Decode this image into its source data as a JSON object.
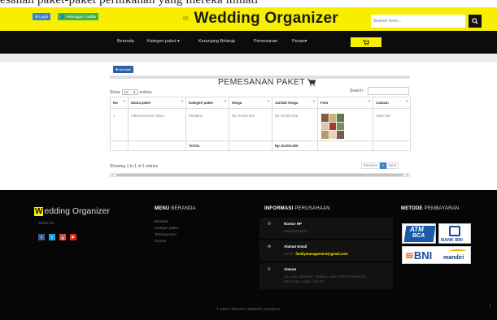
{
  "cut_text": "esanan paket-paket pernikahan yang mereka minati",
  "topbar": {
    "login_label": "⚙ Login",
    "register_label": "👤 Pelanggan / Daftar",
    "brand": "Wedding Organizer",
    "search_placeholder": "Search here..."
  },
  "nav": {
    "items": [
      "Beranda",
      "Kategori paket ▾",
      "Keranjang Belanja",
      "Pemesanan",
      "Pesan▾"
    ]
  },
  "content": {
    "back_label": "✚ Kembali",
    "title": "PEMESANAN PAKET",
    "show_label": "Show",
    "entries_value": "10",
    "entries_label": "entries",
    "search_label": "Search:",
    "columns": [
      "No",
      "Nama paket",
      "Kategori paket",
      "Harga",
      "Jumlah Harga",
      "Foto",
      "Catatan"
    ],
    "rows": [
      {
        "no": "1",
        "nama": "Paket Dekorasi Silver",
        "kategori": "Wedding",
        "harga": "Rp 15.000.000",
        "jumlah": "Rp 15.000.000",
        "catatan": "Hallo kak"
      }
    ],
    "total_label": "TOTAL",
    "total_value": "Rp 15.000.000",
    "info": "Showing 1 to 1 of 1 entries",
    "pagination": {
      "prev": "Previous",
      "page": "1",
      "next": "Next"
    }
  },
  "footer": {
    "logo_w": "W",
    "logo_rest": "edding Organizer",
    "share_label": "Share On:",
    "menu_heading_bold": "MENU",
    "menu_heading_rest": " BERANDA",
    "menu_links": [
      "Beranda",
      "Kategori paket",
      "Tentang kami",
      "Kontak"
    ],
    "info_heading_bold": "INFORMASI",
    "info_heading_rest": " PERUSAHAAN",
    "phone_label": "Nomor HP",
    "phone_value": "081232933933",
    "email_label": "Alamat Email",
    "email_prefix": "Email : ",
    "email_value": "familymanagement@gmail.com",
    "address_label": "Alamat",
    "address_line1": "Jl.Lorem Jaksanta - Madiun, Jawa Timur Perumahan",
    "address_line2": "Bumi Mas 1 Blok J No 19",
    "payment_heading_bold": "METODE",
    "payment_heading_rest": " PEMBAYARAN",
    "copyright": "© 2024 IRMANA HENDRA ANISEYA",
    "pay": {
      "atm": "ATM",
      "bca": "BCA",
      "bri": "BANK BRI",
      "bni": "BNI",
      "mandiri": "mandiri"
    }
  },
  "colors": {
    "accent": "#f7ee00",
    "nav_bg": "#0c0c0c",
    "footer_bg": "#060606",
    "link_blue": "#3a7fd1"
  }
}
